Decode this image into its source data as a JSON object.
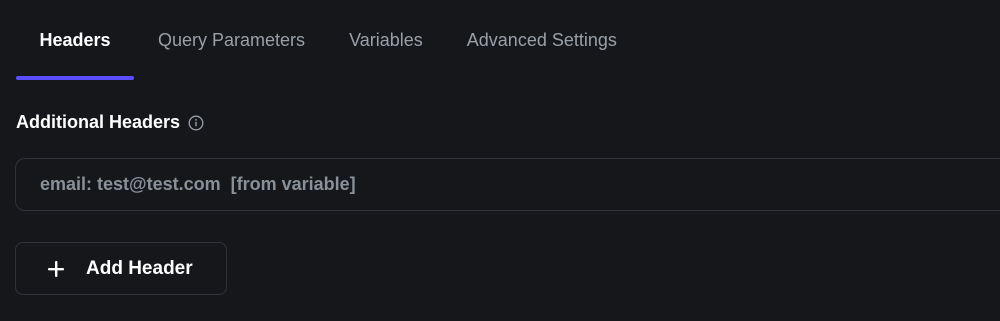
{
  "tabs": [
    {
      "label": "Headers",
      "active": true
    },
    {
      "label": "Query Parameters",
      "active": false
    },
    {
      "label": "Variables",
      "active": false
    },
    {
      "label": "Advanced Settings",
      "active": false
    }
  ],
  "section": {
    "label": "Additional Headers",
    "icon": "info-icon"
  },
  "header_input": {
    "placeholder": "email: test@test.com  [from variable]",
    "value": ""
  },
  "add_button": {
    "label": "Add Header",
    "icon": "plus-icon"
  },
  "colors": {
    "background": "#15171b",
    "accent": "#5b4dff",
    "border": "#30343a",
    "muted_text": "#9aa0a8"
  }
}
